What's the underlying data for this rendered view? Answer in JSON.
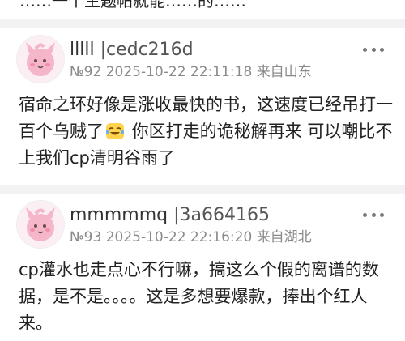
{
  "top_cutoff_text": "……一个主题帖就能……的……",
  "posts": [
    {
      "username": "lllll",
      "uid": "|cedc216d",
      "floor": "№92",
      "datetime": "2025-10-22 22:11:18",
      "location": "来自山东",
      "content_part1": "宿命之环好像是涨收最快的书，这速度已经吊打一百个乌贼了",
      "emoji_name": "crying-laughing-emoji",
      "content_part2": " 你区打走的诡秘解再来 可以嘲比不上我们cp清明谷雨了"
    },
    {
      "username": "mmmmmq",
      "uid": "|3a664165",
      "floor": "№93",
      "datetime": "2025-10-22 22:16:20",
      "location": "来自湖北",
      "content": "cp灌水也走点心不行嘛，搞这么个假的离谱的数据，是不是。。。。这是多想要爆款，捧出个红人来。"
    }
  ],
  "colors": {
    "separator": "#f2f2f2",
    "meta_text": "#8a8a8a",
    "avatar_pink": "#f4b6c8"
  }
}
